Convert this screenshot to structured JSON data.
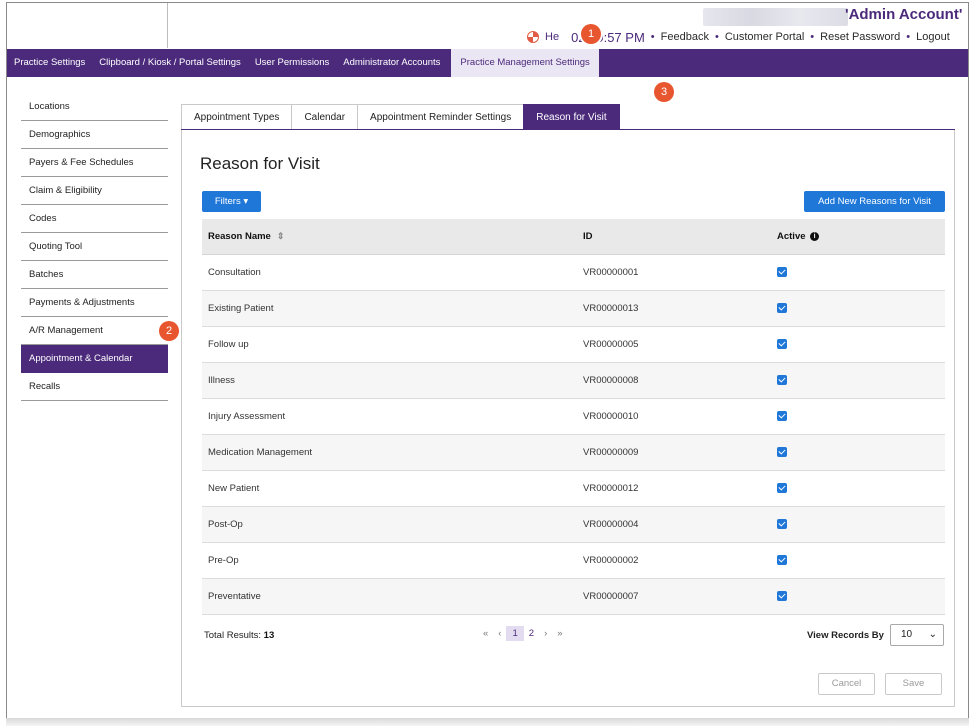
{
  "header": {
    "account_name": "'Admin Account'",
    "help_label": "He",
    "time": "02:59:57 PM",
    "separator": "•",
    "links": [
      "Feedback",
      "Customer Portal",
      "Reset Password",
      "Logout"
    ]
  },
  "nav": {
    "items": [
      "Practice Settings",
      "Clipboard / Kiosk / Portal Settings",
      "User Permissions",
      "Administrator Accounts",
      "Practice Management Settings"
    ],
    "active_index": 4
  },
  "sidebar": {
    "items": [
      "Locations",
      "Demographics",
      "Payers & Fee Schedules",
      "Claim & Eligibility",
      "Codes",
      "Quoting Tool",
      "Batches",
      "Payments & Adjustments",
      "A/R Management",
      "Appointment & Calendar",
      "Recalls"
    ],
    "active_index": 9
  },
  "tabs": {
    "items": [
      "Appointment Types",
      "Calendar",
      "Appointment Reminder Settings",
      "Reason for Visit"
    ],
    "active_index": 3
  },
  "main": {
    "title": "Reason for Visit",
    "filters_label": "Filters",
    "add_label": "Add New Reasons for Visit",
    "columns": [
      "Reason Name",
      "ID",
      "Active"
    ],
    "rows": [
      {
        "name": "Consultation",
        "id": "VR00000001",
        "active": true
      },
      {
        "name": "Existing Patient",
        "id": "VR00000013",
        "active": true
      },
      {
        "name": "Follow up",
        "id": "VR00000005",
        "active": true
      },
      {
        "name": "Illness",
        "id": "VR00000008",
        "active": true
      },
      {
        "name": "Injury Assessment",
        "id": "VR00000010",
        "active": true
      },
      {
        "name": "Medication Management",
        "id": "VR00000009",
        "active": true
      },
      {
        "name": "New Patient",
        "id": "VR00000012",
        "active": true
      },
      {
        "name": "Post-Op",
        "id": "VR00000004",
        "active": true
      },
      {
        "name": "Pre-Op",
        "id": "VR00000002",
        "active": true
      },
      {
        "name": "Preventative",
        "id": "VR00000007",
        "active": true
      }
    ],
    "total_label": "Total Results:",
    "total_value": "13",
    "pagination": {
      "first": "«",
      "prev": "‹",
      "pages": [
        "1",
        "2"
      ],
      "current": "1",
      "next": "›",
      "last": "»"
    },
    "view_by_label": "View Records By",
    "view_by_value": "10",
    "cancel_label": "Cancel",
    "save_label": "Save"
  },
  "callouts": [
    "1",
    "2",
    "3"
  ],
  "colors": {
    "brand": "#4b2a7b",
    "accent": "#1f78d8",
    "callout": "#e8562f"
  }
}
